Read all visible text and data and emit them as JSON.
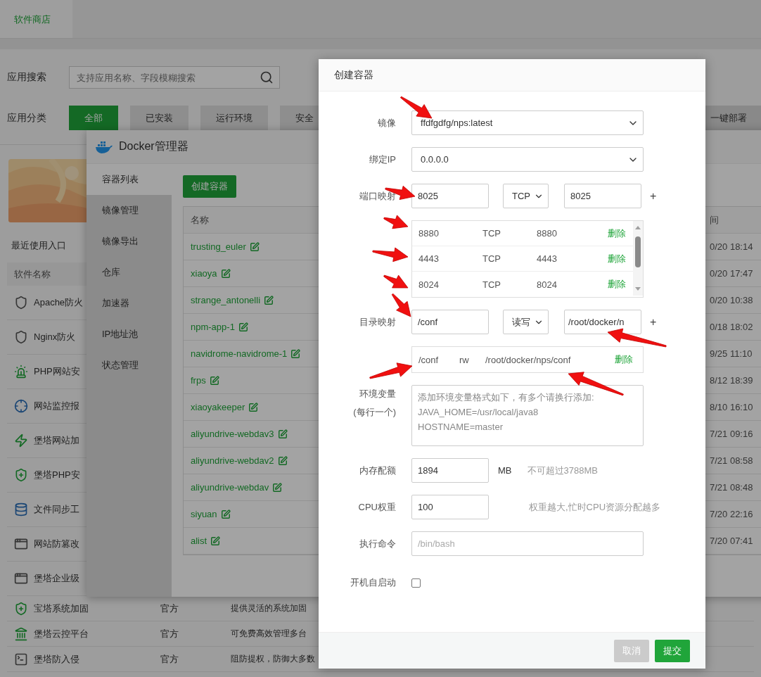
{
  "page_tabs": [
    {
      "label": "软件商店",
      "selected": true
    }
  ],
  "search": {
    "label": "应用搜索",
    "placeholder": "支持应用名称、字段模糊搜索"
  },
  "categories": {
    "label": "应用分类",
    "items": [
      {
        "label": "全部",
        "selected": true
      },
      {
        "label": "已安装",
        "selected": false
      },
      {
        "label": "运行环境",
        "selected": false
      },
      {
        "label": "安全",
        "selected": false
      }
    ]
  },
  "deploy_button": "一键部署",
  "recent_label": "最近使用入口",
  "software_table": {
    "header": "软件名称",
    "rows": [
      {
        "name": "Apache防火"
      },
      {
        "name": "Nginx防火"
      },
      {
        "name": "PHP网站安"
      },
      {
        "name": "网站监控报"
      },
      {
        "name": "堡塔网站加"
      },
      {
        "name": "堡塔PHP安"
      },
      {
        "name": "文件同步工"
      },
      {
        "name": "网站防篡改"
      },
      {
        "name": "堡塔企业级"
      },
      {
        "name": "宝塔系统加固",
        "column_2": "官方",
        "column_3": "提供灵活的系统加固"
      },
      {
        "name": "堡塔云控平台",
        "column_2": "官方",
        "column_3": "可免费高效管理多台"
      },
      {
        "name": "堡塔防入侵",
        "column_2": "官方",
        "column_3": "阻防提权，防御大多数"
      }
    ]
  },
  "docker": {
    "title": "Docker管理器",
    "sidebar": [
      {
        "label": "容器列表",
        "selected": true
      },
      {
        "label": "镜像管理",
        "selected": false
      },
      {
        "label": "镜像导出",
        "selected": false
      },
      {
        "label": "仓库",
        "selected": false
      },
      {
        "label": "加速器",
        "selected": false
      },
      {
        "label": "IP地址池",
        "selected": false
      },
      {
        "label": "状态管理",
        "selected": false
      }
    ],
    "create_button": "创建容器",
    "columns": [
      "名称",
      "间"
    ],
    "rows": [
      {
        "name": "trusting_euler",
        "time": "0/20 18:14"
      },
      {
        "name": "xiaoya",
        "time": "0/20 17:47"
      },
      {
        "name": "strange_antonelli",
        "time": "0/20 10:38"
      },
      {
        "name": "npm-app-1",
        "time": "0/18 18:02"
      },
      {
        "name": "navidrome-navidrome-1",
        "time": "9/25 11:10"
      },
      {
        "name": "frps",
        "time": "8/12 18:39"
      },
      {
        "name": "xiaoyakeeper",
        "time": "8/10 16:10"
      },
      {
        "name": "aliyundrive-webdav3",
        "time": "7/21 09:16"
      },
      {
        "name": "aliyundrive-webdav2",
        "time": "7/21 08:58"
      },
      {
        "name": "aliyundrive-webdav",
        "time": "7/21 08:48"
      },
      {
        "name": "siyuan",
        "time": "7/20 22:16"
      },
      {
        "name": "alist",
        "time": "7/20 07:41"
      }
    ]
  },
  "modal": {
    "title": "创建容器",
    "image": {
      "label": "镜像",
      "value": "ffdfgdfg/nps:latest"
    },
    "bind_ip": {
      "label": "绑定IP",
      "value": "0.0.0.0"
    },
    "port_mapping": {
      "label": "端口映射",
      "host": "8025",
      "protocol": "TCP",
      "container": "8025",
      "add": "+",
      "entries": [
        {
          "host": "8880",
          "protocol": "TCP",
          "container": "8880",
          "action": "删除"
        },
        {
          "host": "4443",
          "protocol": "TCP",
          "container": "4443",
          "action": "删除"
        },
        {
          "host": "8024",
          "protocol": "TCP",
          "container": "8024",
          "action": "删除"
        }
      ]
    },
    "dir_mapping": {
      "label": "目录映射",
      "host": "/conf",
      "mode": "读写",
      "container": "/root/docker/n",
      "add": "+",
      "entries": [
        {
          "host": "/conf",
          "mode": "rw",
          "container": "/root/docker/nps/conf",
          "action": "删除"
        }
      ]
    },
    "env": {
      "label": "环境变量",
      "sublabel": "(每行一个)",
      "placeholder": "添加环境变量格式如下，有多个请换行添加:\nJAVA_HOME=/usr/local/java8\nHOSTNAME=master"
    },
    "memory": {
      "label": "内存配额",
      "value": "1894",
      "unit": "MB",
      "hint": "不可超过3788MB"
    },
    "cpu": {
      "label": "CPU权重",
      "value": "100",
      "hint": "权重越大,忙时CPU资源分配越多"
    },
    "command": {
      "label": "执行命令",
      "placeholder": "/bin/bash"
    },
    "autostart": {
      "label": "开机自启动",
      "checked": false
    },
    "buttons": [
      {
        "label": "取消",
        "kind": "cancel"
      },
      {
        "label": "提交",
        "kind": "submit"
      }
    ]
  }
}
